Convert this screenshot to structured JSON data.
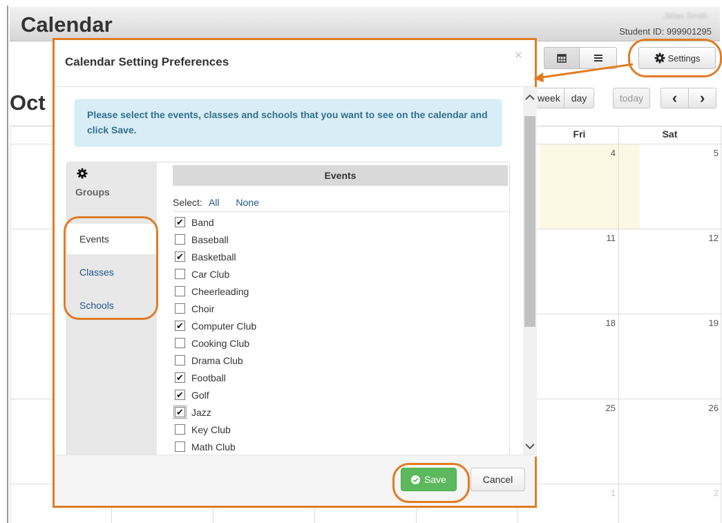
{
  "page": {
    "title": "Calendar",
    "student_name": "Jillian Smith",
    "student_id": "Student ID: 999901295",
    "month_title": "Oct",
    "toolbar": {
      "settings_label": "Settings",
      "month_view_icon": "calendar-grid-icon",
      "list_view_icon": "list-icon"
    },
    "view_buttons": {
      "week": "week",
      "day": "day",
      "today": "today",
      "prev": "‹",
      "next": "›"
    },
    "day_headers": [
      "Fri",
      "Sat"
    ],
    "fri_dates": [
      "4",
      "11",
      "18",
      "25",
      "1"
    ],
    "sat_dates": [
      "5",
      "12",
      "19",
      "26",
      "2"
    ]
  },
  "modal": {
    "title": "Calendar Setting Preferences",
    "close": "×",
    "info": "Please select the events, classes and schools that you want to see on the calendar and click Save.",
    "groups_label": "Groups",
    "nav": [
      {
        "label": "Events",
        "active": true
      },
      {
        "label": "Classes",
        "active": false
      },
      {
        "label": "Schools",
        "active": false
      }
    ],
    "events_header": "Events",
    "select_label": "Select:",
    "select_all": "All",
    "select_none": "None",
    "events": [
      {
        "label": "Band",
        "checked": true
      },
      {
        "label": "Baseball",
        "checked": false
      },
      {
        "label": "Basketball",
        "checked": true
      },
      {
        "label": "Car Club",
        "checked": false
      },
      {
        "label": "Cheerleading",
        "checked": false
      },
      {
        "label": "Choir",
        "checked": false
      },
      {
        "label": "Computer Club",
        "checked": true
      },
      {
        "label": "Cooking Club",
        "checked": false
      },
      {
        "label": "Drama Club",
        "checked": false
      },
      {
        "label": "Football",
        "checked": true
      },
      {
        "label": "Golf",
        "checked": true
      },
      {
        "label": "Jazz",
        "checked": true,
        "focused": true
      },
      {
        "label": "Key Club",
        "checked": false
      },
      {
        "label": "Math Club",
        "checked": false
      }
    ],
    "save_label": "Save",
    "cancel_label": "Cancel"
  },
  "colors": {
    "annotation": "#e07b24",
    "save": "#5cb85c",
    "info_bg": "#d9edf7",
    "info_text": "#31708f",
    "link": "#24568c",
    "today_bg": "#fcf8e3"
  }
}
